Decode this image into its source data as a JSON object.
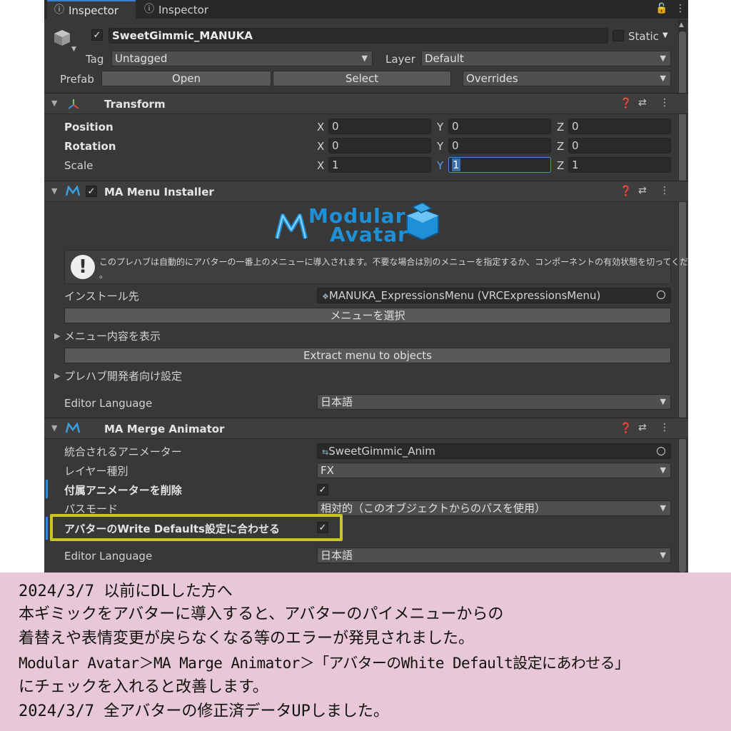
{
  "tabs": [
    {
      "label": "Inspector"
    },
    {
      "label": "Inspector"
    }
  ],
  "object": {
    "name": "SweetGimmic_MANUKA",
    "static_label": "Static",
    "tag_label": "Tag",
    "tag_value": "Untagged",
    "layer_label": "Layer",
    "layer_value": "Default",
    "prefab_label": "Prefab",
    "open_label": "Open",
    "select_label": "Select",
    "overrides_label": "Overrides"
  },
  "transform": {
    "title": "Transform",
    "rows": [
      {
        "label": "Position",
        "x": "0",
        "y": "0",
        "z": "0"
      },
      {
        "label": "Rotation",
        "x": "0",
        "y": "0",
        "z": "0"
      },
      {
        "label": "Scale",
        "x": "1",
        "y": "1",
        "z": "1"
      }
    ],
    "axis_x": "X",
    "axis_y": "Y",
    "axis_z": "Z"
  },
  "menu_installer": {
    "title": "MA Menu Installer",
    "logo_line1": "Modular",
    "logo_line2": "Avatar",
    "info_line1": "このプレハブは自動的にアバターの一番上のメニューに導入されます。不要な場合は別のメニューを指定するか、コンポーネントの有効状態を切ってください",
    "info_line2": "。",
    "install_label": "インストール先",
    "install_value": "MANUKA_ExpressionsMenu (VRCExpressionsMenu)",
    "select_menu_button": "メニューを選択",
    "show_contents": "メニュー内容を表示",
    "extract_button": "Extract menu to objects",
    "dev_settings": "プレハブ開発者向け設定",
    "editor_language_label": "Editor Language",
    "editor_language_value": "日本語"
  },
  "merge_animator": {
    "title": "MA Merge Animator",
    "animator_label": "統合されるアニメーター",
    "animator_value": "SweetGimmic_Anim",
    "layer_type_label": "レイヤー種別",
    "layer_type_value": "FX",
    "delete_label": "付属アニメーターを削除",
    "path_mode_label": "パスモード",
    "path_mode_value": "相対的（このオブジェクトからのパスを使用）",
    "wd_label": "アバターのWrite Defaults設定に合わせる",
    "editor_language_label": "Editor Language",
    "editor_language_value": "日本語"
  },
  "notice": {
    "lines": [
      "2024/3/7 以前にDLした方へ",
      "本ギミックをアバターに導入すると、アバターのパイメニューからの",
      "着替えや表情変更が戻らなくなる等のエラーが発見されました。",
      "Modular Avatar＞MA Marge Animator＞「アバターのWhite Default設定にあわせる」",
      "にチェックを入れると改善します。",
      "2024/3/7 全アバターの修正済データUPしました。"
    ]
  },
  "colors": {
    "highlight": "#c8c42a",
    "accent_blue": "#3aa0e0",
    "selected_field": "#3d6ea8"
  }
}
